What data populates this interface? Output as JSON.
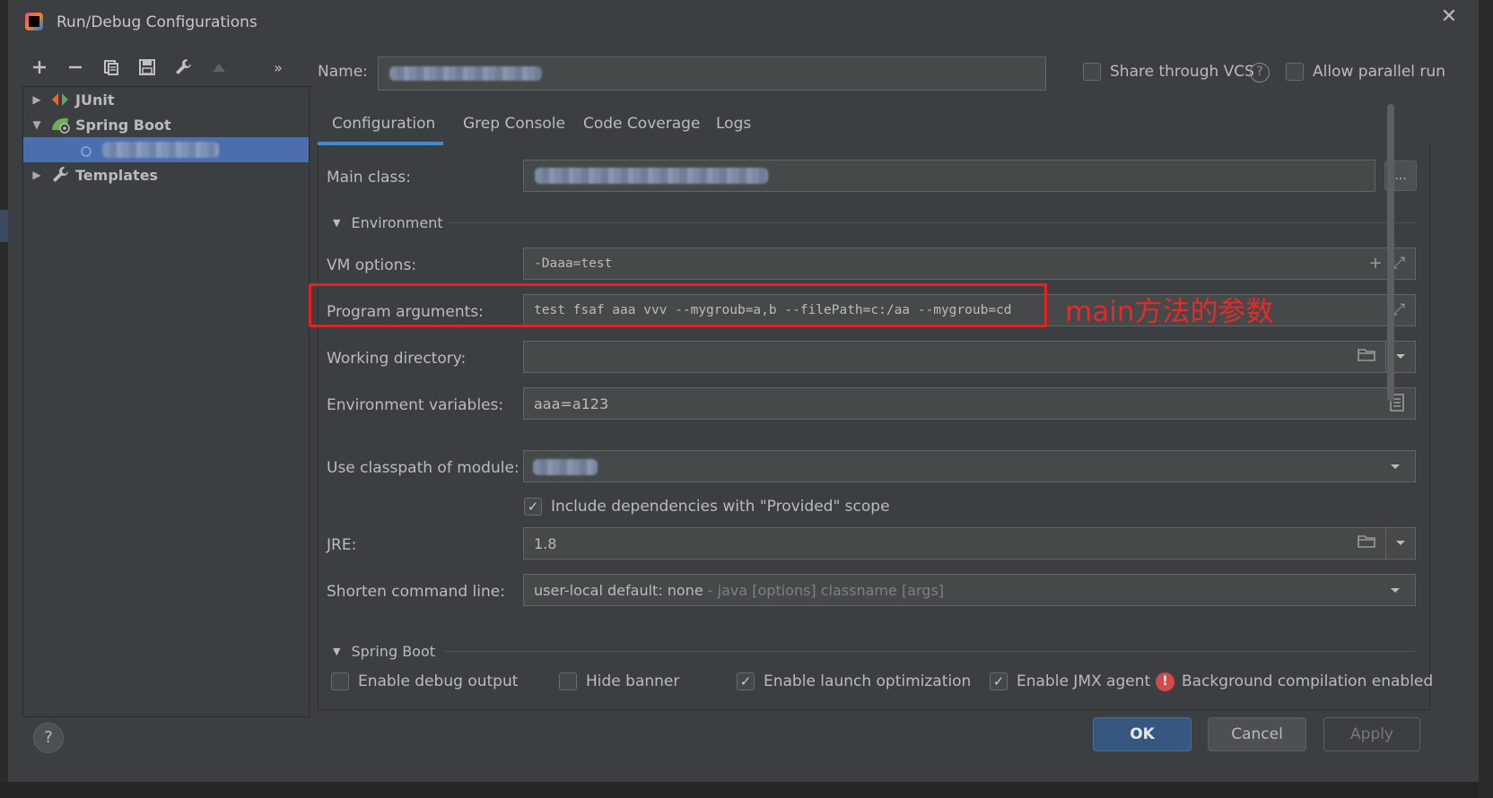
{
  "window": {
    "title": "Run/Debug Configurations"
  },
  "toolbar": {
    "add": "+",
    "remove": "−",
    "more": "»"
  },
  "tree": {
    "items": [
      {
        "label": "JUnit"
      },
      {
        "label": "Spring Boot"
      },
      {
        "label": "Templates"
      }
    ]
  },
  "header": {
    "name_label": "Name:",
    "share_vcs": "Share through VCS",
    "allow_parallel": "Allow parallel run"
  },
  "tabs": [
    {
      "label": "Configuration"
    },
    {
      "label": "Grep Console"
    },
    {
      "label": "Code Coverage"
    },
    {
      "label": "Logs"
    }
  ],
  "config": {
    "main_class_label": "Main class:",
    "main_class_button": "...",
    "environment_section": "Environment",
    "vm_options_label": "VM options:",
    "vm_options_value": "-Daaa=test",
    "program_args_label": "Program arguments:",
    "program_args_value": "test fsaf aaa vvv --mygroub=a,b --filePath=c:/aa --mygroub=cd",
    "working_dir_label": "Working directory:",
    "env_vars_label": "Environment variables:",
    "env_vars_value": "aaa=a123",
    "classpath_label": "Use classpath of module:",
    "include_deps": "Include dependencies with \"Provided\" scope",
    "jre_label": "JRE:",
    "jre_value": "1.8",
    "shorten_label": "Shorten command line:",
    "shorten_value": "user-local default: none",
    "shorten_hint": " - java [options] classname [args]",
    "spring_section": "Spring Boot",
    "enable_debug": "Enable debug output",
    "hide_banner": "Hide banner",
    "launch_opt": "Enable launch optimization",
    "jmx_agent": "Enable JMX agent",
    "bg_compilation": "Background compilation enabled"
  },
  "annotation": {
    "text": "main方法的参数",
    "color": "#e52a2a"
  },
  "footer": {
    "help": "?",
    "ok": "OK",
    "cancel": "Cancel",
    "apply": "Apply"
  },
  "colors": {
    "accent": "#4a88c7",
    "selection": "#4b6eaf",
    "ok_button": "#365880"
  }
}
